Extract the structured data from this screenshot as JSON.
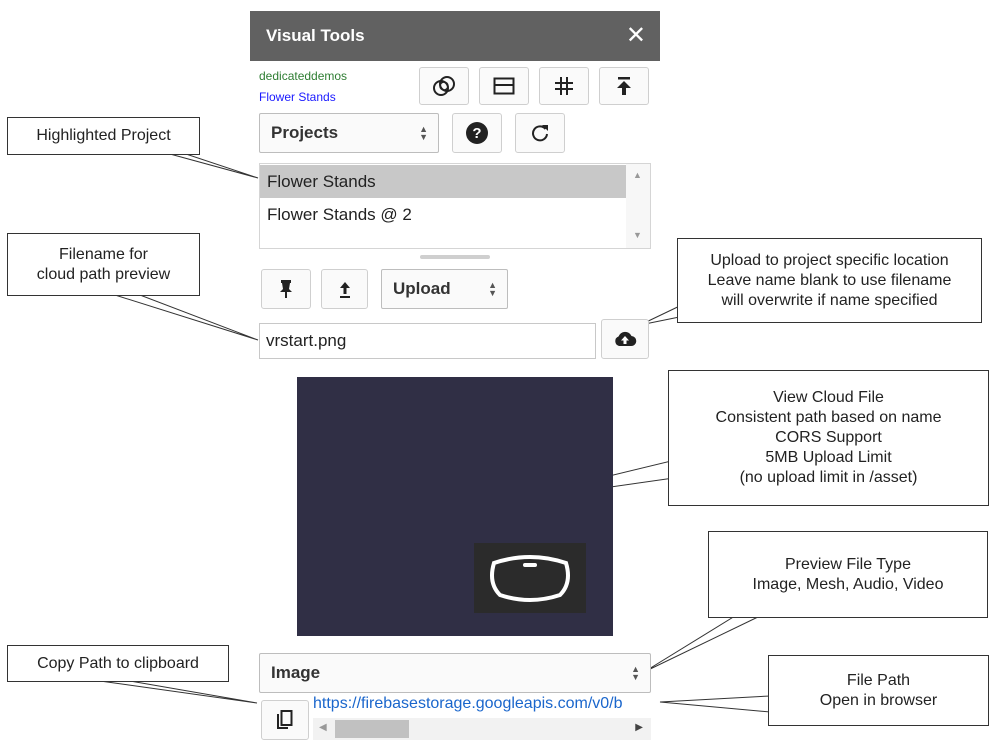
{
  "panel": {
    "title": "Visual Tools",
    "close_glyph": "✕",
    "account_name": "dedicateddemos",
    "project_name": "Flower Stands",
    "projects_select": "Projects",
    "help_glyph": "?",
    "refresh_glyph": "C",
    "projects": [
      "Flower Stands",
      "Flower Stands @ 2"
    ],
    "upload_select": "Upload",
    "filename_value": "vrstart.png",
    "preview_type": "Image",
    "file_path": "https://firebasestorage.googleapis.com/v0/b",
    "colors": {
      "header": "#616161",
      "account": "#2e7d32",
      "project": "#1a1aff",
      "preview_bg": "#302f45",
      "link": "#1a66cc"
    },
    "icons": [
      "overlap-circles-icon",
      "tab-window-icon",
      "grid-hash-icon",
      "upload-top-icon",
      "pin-icon",
      "upload-arrow-icon",
      "cloud-upload-icon",
      "vr-headset-icon",
      "copy-icon"
    ]
  },
  "callouts": {
    "highlighted_project": "Highlighted Project",
    "filename_preview": [
      "Filename for",
      "cloud path preview"
    ],
    "upload_location": [
      "Upload to project specific location",
      "Leave name blank to use filename",
      "will overwrite if name specified"
    ],
    "view_cloud_file": [
      "View Cloud File",
      "Consistent path based on name",
      "CORS Support",
      "5MB Upload Limit",
      "(no upload limit in /asset)"
    ],
    "preview_file_type": [
      "Preview File Type",
      "Image, Mesh, Audio, Video"
    ],
    "copy_path": "Copy Path to clipboard",
    "file_path": [
      "File Path",
      "Open in browser"
    ]
  }
}
